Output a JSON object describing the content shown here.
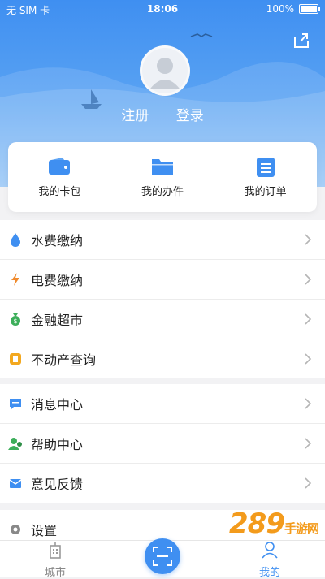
{
  "status_bar": {
    "carrier": "无 SIM 卡",
    "time": "18:06",
    "battery": "100%"
  },
  "header": {
    "register_label": "注册",
    "login_label": "登录"
  },
  "quick_actions": [
    {
      "label": "我的卡包",
      "icon": "wallet-icon"
    },
    {
      "label": "我的办件",
      "icon": "folder-icon"
    },
    {
      "label": "我的订单",
      "icon": "order-icon"
    }
  ],
  "menu_section_1": [
    {
      "label": "水费缴纳",
      "icon": "water-drop-icon",
      "color": "#3f8ff1"
    },
    {
      "label": "电费缴纳",
      "icon": "lightning-icon",
      "color": "#f08a2c"
    },
    {
      "label": "金融超市",
      "icon": "money-bag-icon",
      "color": "#3cae5a"
    },
    {
      "label": "不动产查询",
      "icon": "property-icon",
      "color": "#f3a81f"
    }
  ],
  "menu_section_2": [
    {
      "label": "消息中心",
      "icon": "message-icon",
      "color": "#3f8ff1"
    },
    {
      "label": "帮助中心",
      "icon": "help-user-icon",
      "color": "#3cae5a"
    },
    {
      "label": "意见反馈",
      "icon": "feedback-mail-icon",
      "color": "#3f8ff1"
    }
  ],
  "menu_section_3": [
    {
      "label": "设置",
      "icon": "settings-gear-icon",
      "color": "#888888"
    }
  ],
  "tab_bar": {
    "city_label": "城市",
    "mine_label": "我的"
  },
  "watermark": {
    "text": "289",
    "sub": "手游网"
  },
  "colors": {
    "accent": "#3f8ff1",
    "active_tab": "#3f8ff1",
    "inactive_tab": "#888888"
  }
}
